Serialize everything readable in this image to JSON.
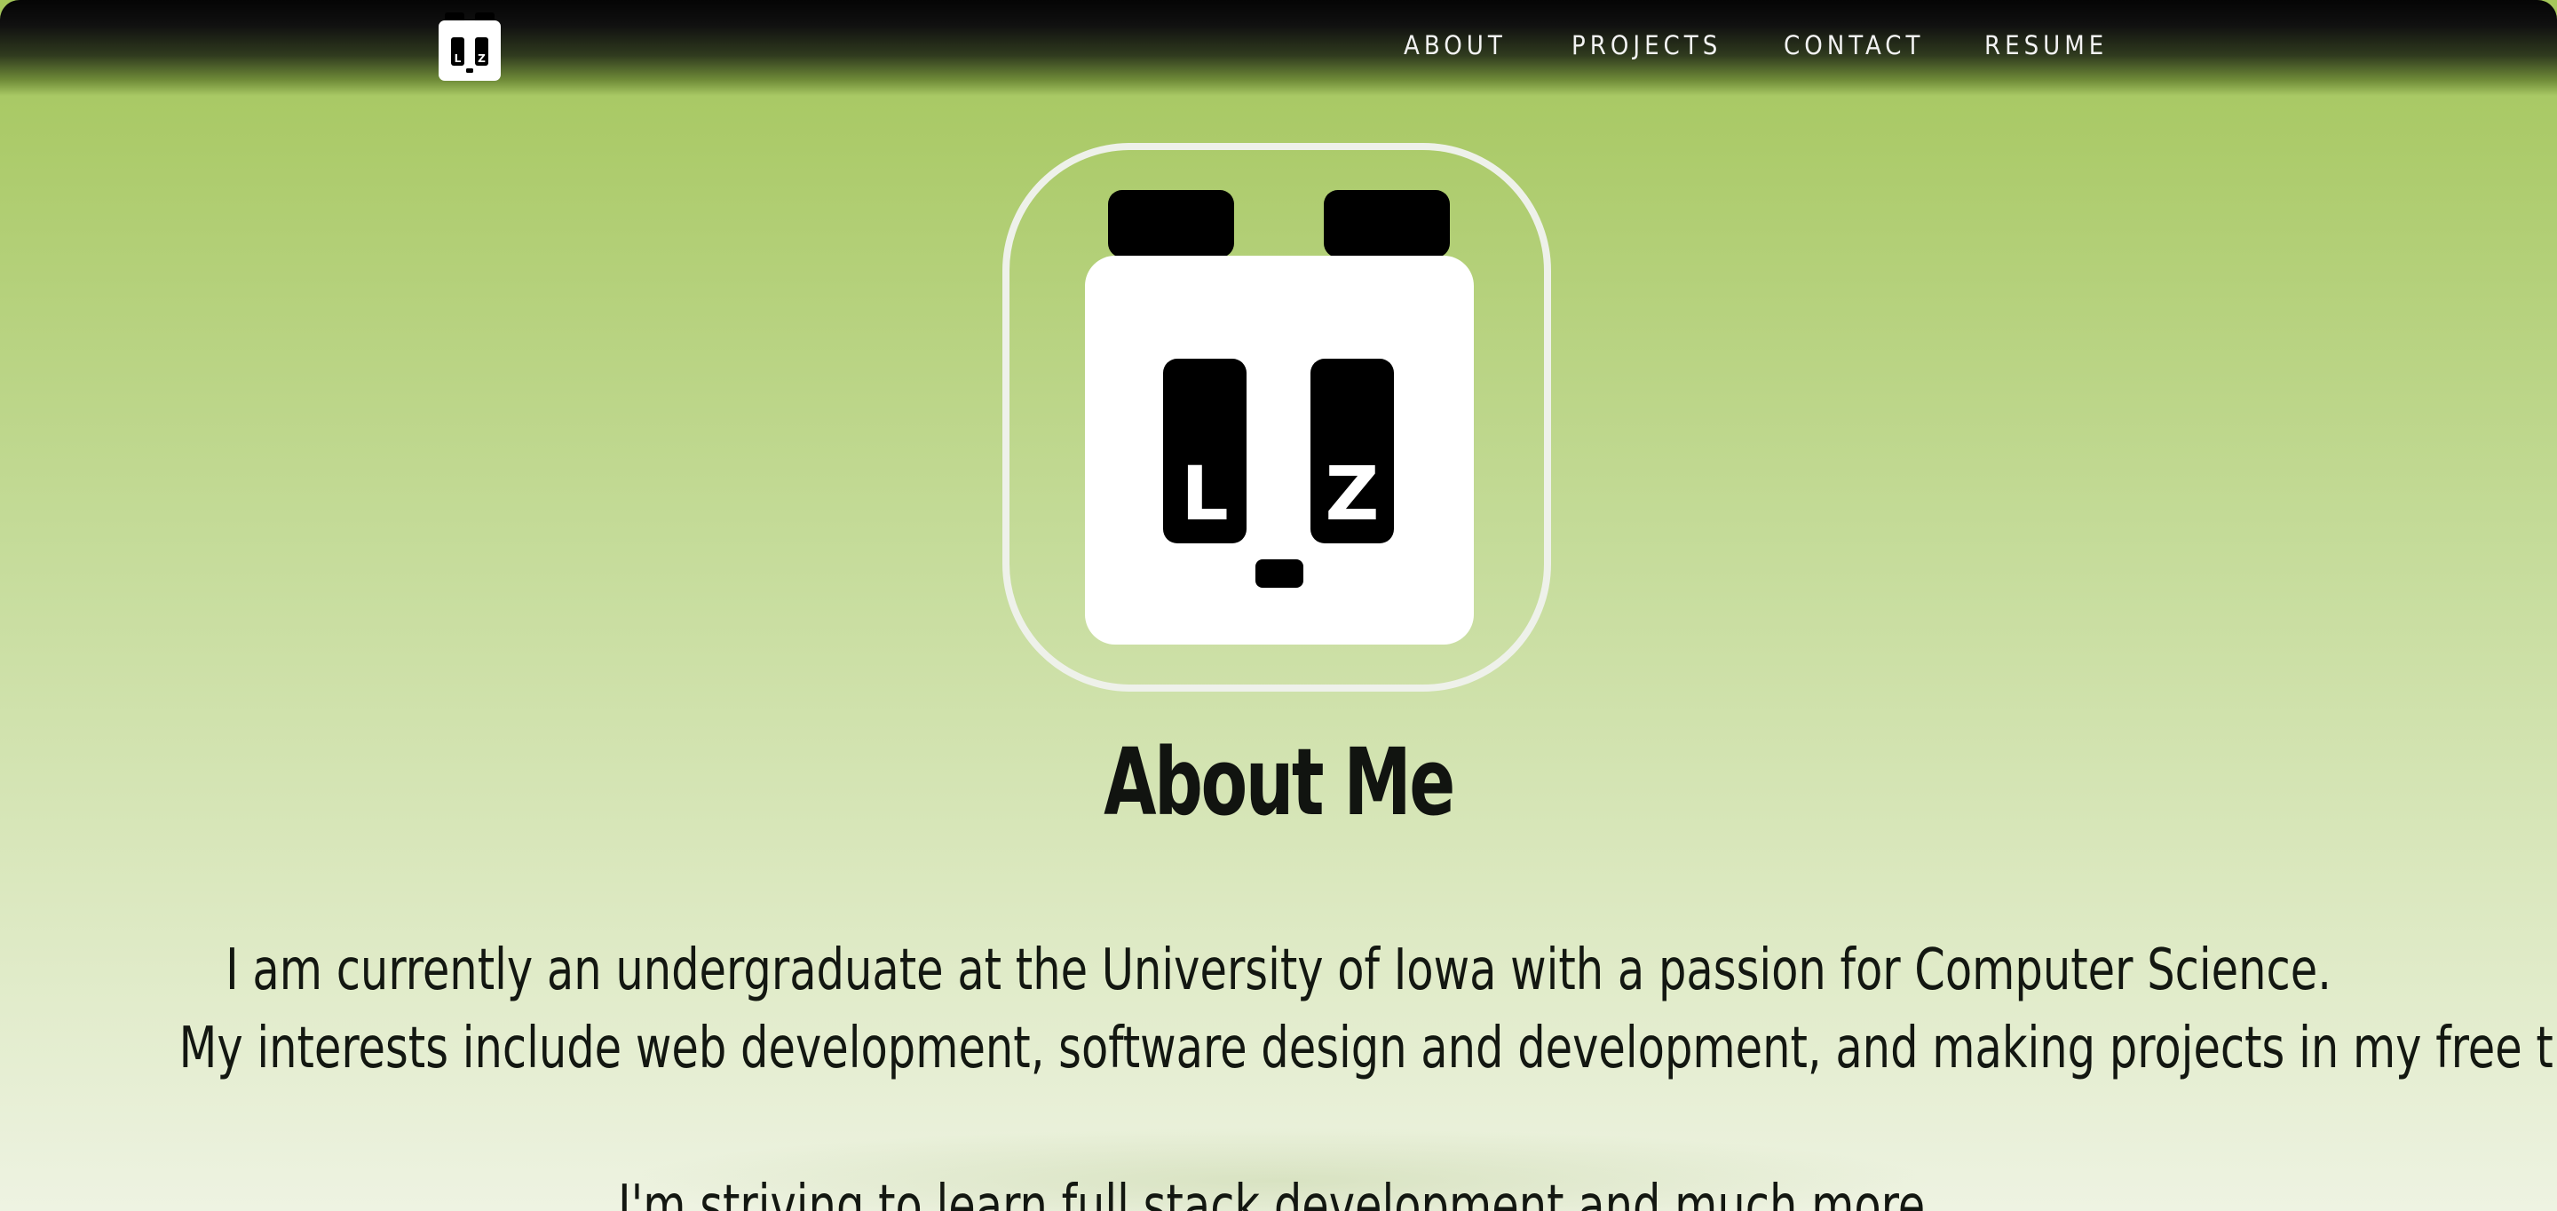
{
  "header": {
    "logo_label": "Lz panda logo",
    "nav": [
      {
        "label": "ABOUT"
      },
      {
        "label": "PROJECTS"
      },
      {
        "label": "CONTACT"
      },
      {
        "label": "RESUME"
      }
    ]
  },
  "hero": {
    "logo_left_letter": "L",
    "logo_right_letter": "Z"
  },
  "about": {
    "title": "About Me",
    "line1": "I am currently an undergraduate at the University of Iowa with a passion for Computer Science.",
    "line2": "My interests include web development, software design and development, and making projects in my free time!",
    "line3": "I'm striving to learn full stack development and much more."
  },
  "colors": {
    "background_top": "#a5c75a",
    "background_bottom": "#eef3e2",
    "header_dark": "#050505",
    "text_dark": "#111410",
    "logo_black": "#000000",
    "logo_white": "#ffffff",
    "ring": "#eef1ea"
  },
  "icons": {
    "nav_logo": "panda-face-icon",
    "hero_logo": "panda-face-icon"
  }
}
